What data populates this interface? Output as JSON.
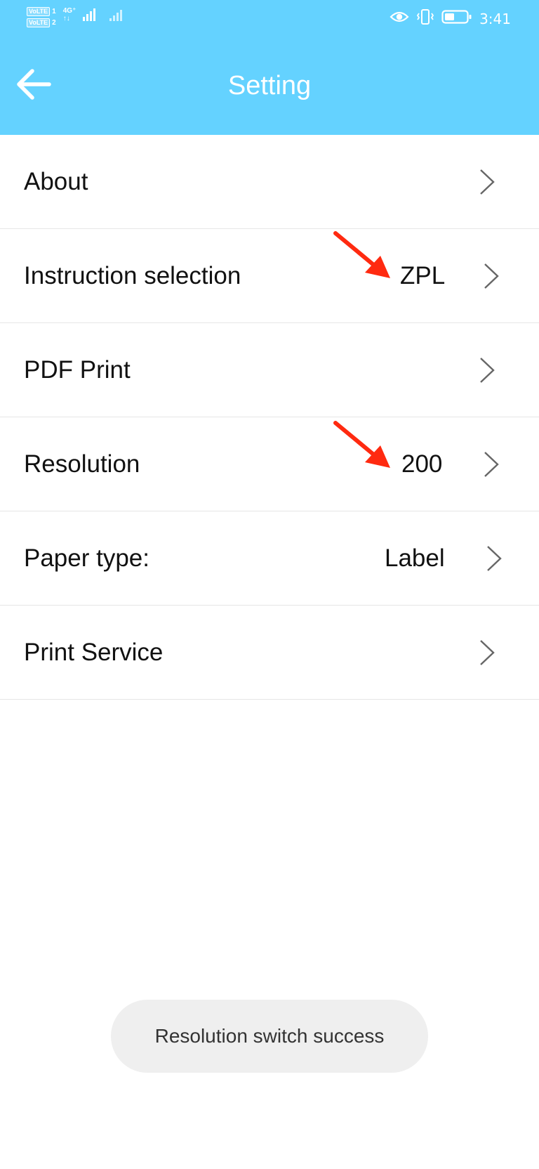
{
  "status_bar": {
    "sim1_label": "VoLTE",
    "sim1_num": "1",
    "sim2_label": "VoLTE",
    "sim2_num": "2",
    "network_type": "4G⁺",
    "data_arrows": "↑↓",
    "time": "3:41",
    "icons": [
      "eye-icon",
      "vibrate-icon",
      "battery-icon"
    ]
  },
  "header": {
    "title": "Setting",
    "back_icon": "arrow-left-icon",
    "background_color": "#64D2FF"
  },
  "settings": {
    "items": [
      {
        "label": "About",
        "value": ""
      },
      {
        "label": "Instruction selection",
        "value": "ZPL"
      },
      {
        "label": "PDF Print",
        "value": ""
      },
      {
        "label": "Resolution",
        "value": "200"
      },
      {
        "label": "Paper type:",
        "value": "Label"
      },
      {
        "label": "Print Service",
        "value": ""
      }
    ],
    "chevron_icon": "chevron-right-icon"
  },
  "annotations": {
    "arrow_color": "#FF2A10"
  },
  "toast": {
    "message": "Resolution switch success"
  }
}
